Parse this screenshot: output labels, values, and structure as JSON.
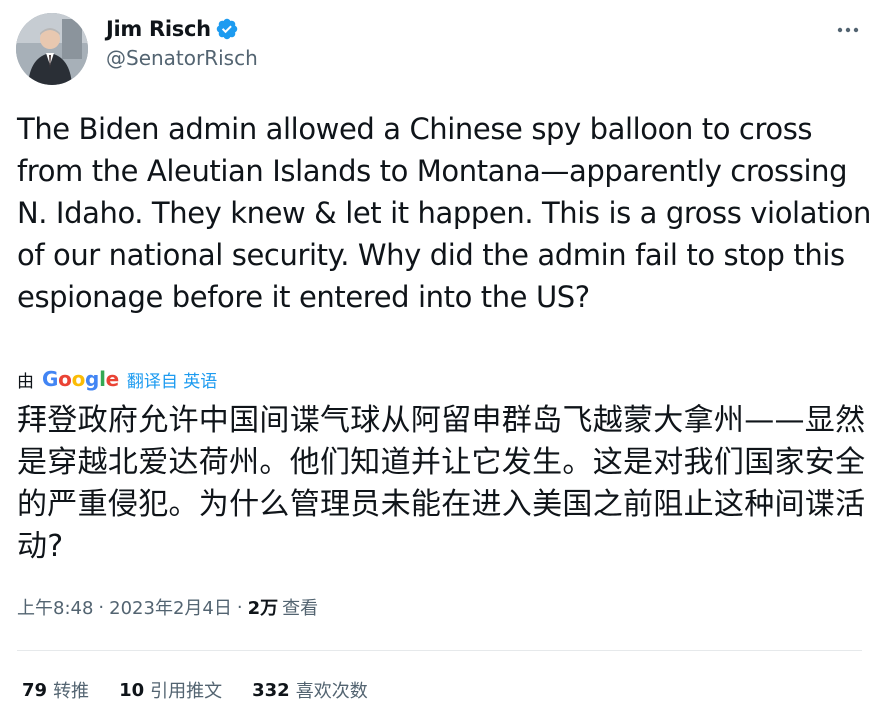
{
  "author": {
    "display_name": "Jim Risch",
    "handle": "@SenatorRisch",
    "verified": true,
    "avatar_icon": "person-photo"
  },
  "tweet": {
    "text": "The Biden admin allowed a Chinese spy balloon to cross from the Aleutian Islands to Montana—apparently crossing N. Idaho. They knew & let it happen. This is a gross violation of our national security. Why did the admin fail to stop this espionage before it entered into the US?"
  },
  "translation": {
    "by_label": "由",
    "provider": "Google",
    "link_label": "翻译自 英语",
    "text": "拜登政府允许中国间谍气球从阿留申群岛飞越蒙大拿州——显然是穿越北爱达荷州。他们知道并让它发生。这是对我们国家安全的严重侵犯。为什么管理员未能在进入美国之前阻止这种间谍活动?"
  },
  "meta": {
    "time": "上午8:48",
    "separator": "·",
    "date": "2023年2月4日",
    "views_count": "2万",
    "views_label": "查看"
  },
  "stats": {
    "retweets_count": "79",
    "retweets_label": "转推",
    "quotes_count": "10",
    "quotes_label": "引用推文",
    "likes_count": "332",
    "likes_label": "喜欢次数"
  },
  "colors": {
    "verified_blue": "#1d9bf0",
    "secondary_text": "#536471",
    "primary_text": "#0f1419",
    "google_blue": "#4285f4",
    "google_red": "#ea4335",
    "google_yellow": "#fbbc05",
    "google_green": "#34a853"
  }
}
